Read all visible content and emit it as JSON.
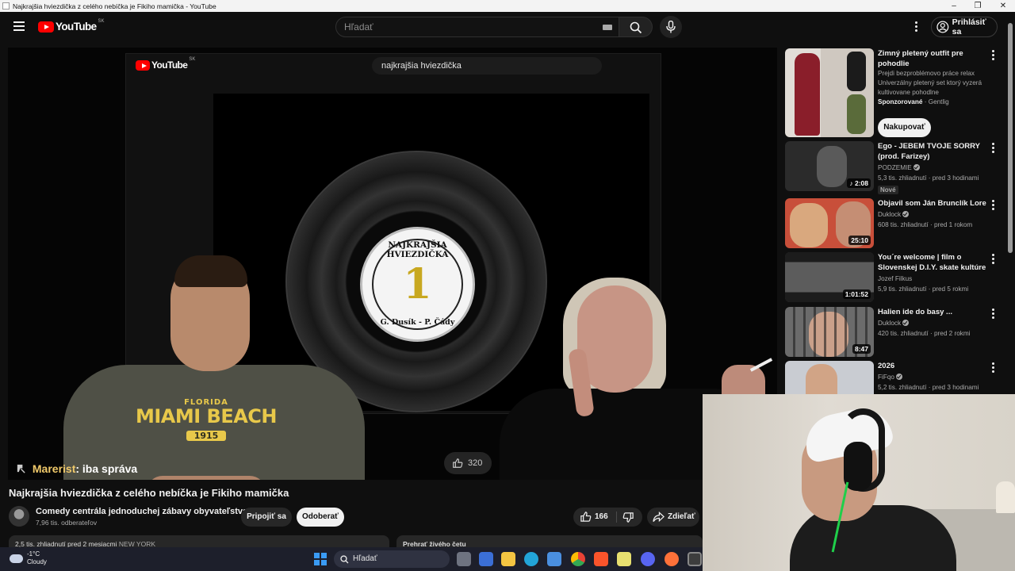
{
  "window": {
    "title": "Najkrajšia hviezdička z celého nebíčka je Fikiho mamička - YouTube",
    "controls": [
      "–",
      "❐",
      "✕"
    ]
  },
  "masthead": {
    "logo_text": "YouTube",
    "country_code": "SK",
    "search_placeholder": "Hľadať",
    "signin_label": "Prihlásiť sa"
  },
  "player": {
    "embedded_logo_text": "YouTube",
    "embedded_country_code": "SK",
    "embedded_search_text": "najkrajšia hviezdička",
    "record_label_top": "NAJKRAJŠIA HVIEZDIČKA",
    "record_label_number": "1",
    "record_label_bottom": "G. Dusík - P. Čády",
    "shirt_line1": "FLORIDA",
    "shirt_line2": "MIAMI BEACH",
    "shirt_line3": "1915",
    "embedded_like_count": "320",
    "overlay_user": "Marerist",
    "overlay_message": ": iba správa"
  },
  "video": {
    "title": "Najkrajšia hviezdička z celého nebíčka je Fikiho mamička",
    "channel_name": "Comedy centrála jednoduchej zábavy obyvateľstva",
    "subscribers": "7,96 tis. odberateľov",
    "join_label": "Pripojiť sa",
    "subscribe_label": "Odoberať",
    "like_count": "166",
    "share_label": "Zdieľať",
    "description_preview": "2,5 tis. zhliadnutí  pred 2 mesiacmi",
    "description_tag": "NEW YORK",
    "chat_replay_label": "Prehrať živého četu"
  },
  "sidebar": {
    "items": [
      {
        "title": "Zimný pletený outfit pre pohodlie",
        "desc1": "Prejdi bezproblémovo práce relax",
        "desc2": "Univerzálny pletený set ktorý vyzerá",
        "desc3": "kultivovane pohodlne",
        "sponsored": "Sponzorované",
        "advertiser": "· Gentlig",
        "cta": "Nakupovať",
        "thumb_color": "#d9d4cf"
      },
      {
        "title": "Ego - JEBEM TVOJE SORRY (prod. Farizey)",
        "channel": "PODZEMIE",
        "meta": "5,3 tis. zhliadnutí · pred 3 hodinami",
        "badge": "Nové",
        "duration": "2:08",
        "thumb_color": "#2b2b2b"
      },
      {
        "title": "Objavil som Ján Brunclík Lore",
        "channel": "Duklock",
        "meta": "608 tis. zhliadnutí · pred 1 rokom",
        "duration": "25:10",
        "thumb_color": "#c84f3a"
      },
      {
        "title": "You´re welcome | film o Slovenskej D.I.Y. skate kultúre",
        "channel": "Jozef Filkus",
        "meta": "5,9 tis. zhliadnutí · pred 5 rokmi",
        "duration": "1:01:52",
        "thumb_color": "#3a3a3a"
      },
      {
        "title": "Halien ide do basy ...",
        "channel": "Duklock",
        "meta": "420 tis. zhliadnutí · pred 2 rokmi",
        "duration": "8:47",
        "thumb_color": "#6b6b6b"
      },
      {
        "title": "2026",
        "channel": "FiFqo",
        "meta": "5,2 tis. zhliadnutí · pred 3 hodinami",
        "thumb_color": "#c9ccd2"
      }
    ]
  },
  "taskbar": {
    "temperature": "-1°C",
    "weather": "Cloudy",
    "search_label": "Hľadať"
  },
  "colors": {
    "background": "#0f0f0f",
    "brand_red": "#ff0000",
    "text": "#f1f1f1",
    "muted": "#aaaaaa",
    "shirt_print": "#e8c84a",
    "overlay_user": "#f0c96a"
  }
}
